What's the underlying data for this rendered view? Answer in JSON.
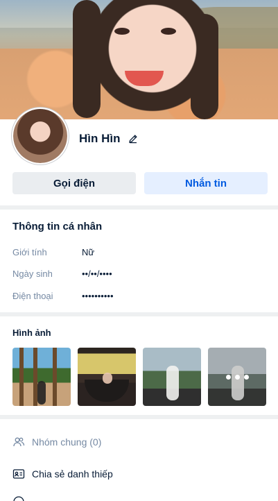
{
  "profile": {
    "name": "Hìn Hìn",
    "call_label": "Gọi điện",
    "message_label": "Nhắn tin"
  },
  "personal_info": {
    "title": "Thông tin cá nhân",
    "rows": [
      {
        "label": "Giới tính",
        "value": "Nữ"
      },
      {
        "label": "Ngày sinh",
        "value": "••/••/••••"
      },
      {
        "label": "Điện thoại",
        "value": "••••••••••"
      }
    ]
  },
  "photos": {
    "title": "Hình ảnh"
  },
  "actions": {
    "common_groups": "Nhóm chung (0)",
    "share_card": "Chia sẻ danh thiếp"
  },
  "colors": {
    "primary": "#005ae0",
    "primary_bg": "#e5efff",
    "secondary_bg": "#eaedf0",
    "muted_text": "#7589a3",
    "separator": "#eef0f1"
  }
}
